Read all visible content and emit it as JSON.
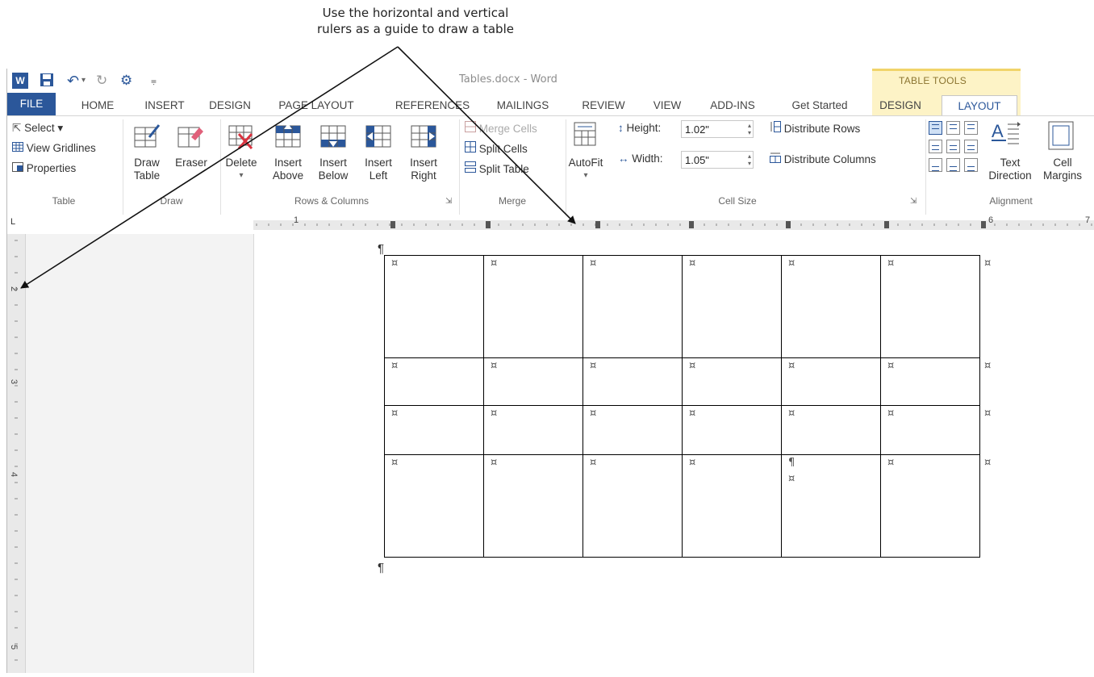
{
  "callout": {
    "line1": "Use the horizontal and vertical",
    "line2": "rulers as a guide to draw a table"
  },
  "titlebar": {
    "doc_title": "Tables.docx - Word",
    "contextual_label": "TABLE TOOLS",
    "qat": [
      "word-icon",
      "save-icon",
      "undo-icon",
      "redo-icon",
      "touch-mode-icon",
      "customize-qat-icon"
    ],
    "qat_symbols": [
      "W",
      "■",
      "↶",
      "↻",
      "⚙",
      "⩦"
    ]
  },
  "tabs": {
    "file": "FILE",
    "home": "HOME",
    "insert": "INSERT",
    "design": "DESIGN",
    "page_layout": "PAGE LAYOUT",
    "references": "REFERENCES",
    "mailings": "MAILINGS",
    "review": "REVIEW",
    "view": "VIEW",
    "addins": "ADD-INS",
    "get_started": "Get Started",
    "table_design": "DESIGN",
    "table_layout": "LAYOUT"
  },
  "ribbon": {
    "table": {
      "label": "Table",
      "select": "Select ▾",
      "view_gridlines": "View Gridlines",
      "properties": "Properties"
    },
    "draw": {
      "label": "Draw",
      "draw_table_1": "Draw",
      "draw_table_2": "Table",
      "eraser": "Eraser"
    },
    "rows_columns": {
      "label": "Rows & Columns",
      "delete": "Delete",
      "delete_arrow": "▾",
      "insert_above_1": "Insert",
      "insert_above_2": "Above",
      "insert_below_1": "Insert",
      "insert_below_2": "Below",
      "insert_left_1": "Insert",
      "insert_left_2": "Left",
      "insert_right_1": "Insert",
      "insert_right_2": "Right"
    },
    "merge": {
      "label": "Merge",
      "merge_cells": "Merge Cells",
      "split_cells": "Split Cells",
      "split_table": "Split Table"
    },
    "cell_size": {
      "label": "Cell Size",
      "autofit": "AutoFit",
      "autofit_arrow": "▾",
      "height_label": "Height:",
      "height_value": "1.02\"",
      "width_label": "Width:",
      "width_value": "1.05\"",
      "distribute_rows": "Distribute Rows",
      "distribute_columns": "Distribute Columns"
    },
    "alignment": {
      "label": "Alignment",
      "text_direction_1": "Text",
      "text_direction_2": "Direction",
      "cell_margins_1": "Cell",
      "cell_margins_2": "Margins"
    }
  },
  "ruler": {
    "h_numbers": [
      "1",
      "6",
      "7"
    ],
    "v_numbers": [
      "2",
      "3",
      "4",
      "5"
    ],
    "corner": "L"
  },
  "document": {
    "paragraph_mark": "¶",
    "cell_mark": "¤",
    "rows": 4,
    "cols": 6
  }
}
